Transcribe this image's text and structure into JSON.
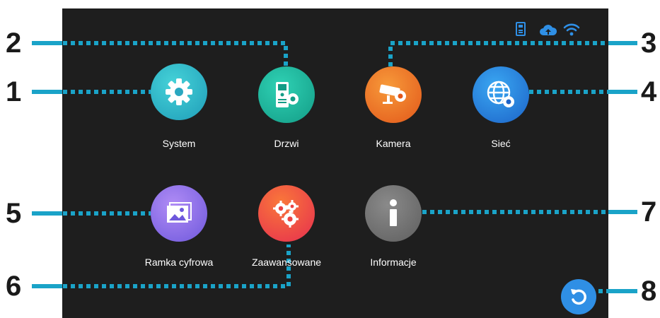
{
  "apps": [
    {
      "key": "system",
      "label": "System"
    },
    {
      "key": "drzwi",
      "label": "Drzwi"
    },
    {
      "key": "kamera",
      "label": "Kamera"
    },
    {
      "key": "siec",
      "label": "Sieć"
    },
    {
      "key": "ramka",
      "label": "Ramka cyfrowa"
    },
    {
      "key": "zaawansowane",
      "label": "Zaawansowane"
    },
    {
      "key": "informacje",
      "label": "Informacje"
    }
  ],
  "callouts": [
    "1",
    "2",
    "3",
    "4",
    "5",
    "6",
    "7",
    "8"
  ],
  "status_icons": [
    "outdoor-station-icon",
    "cloud-upload-icon",
    "wifi-icon"
  ],
  "colors": {
    "screen_bg": "#1e1e1e",
    "callout_dots": "#1aa3c8",
    "status_blue": "#2f8fe5",
    "system": "#2ab0c5",
    "drzwi": "#1cb59a",
    "kamera": "#ee6d1c",
    "siec": "#2a7fdc",
    "ramka": "#8a6fe8",
    "zaawansowane": "#f0453f",
    "informacje": "#707070"
  }
}
